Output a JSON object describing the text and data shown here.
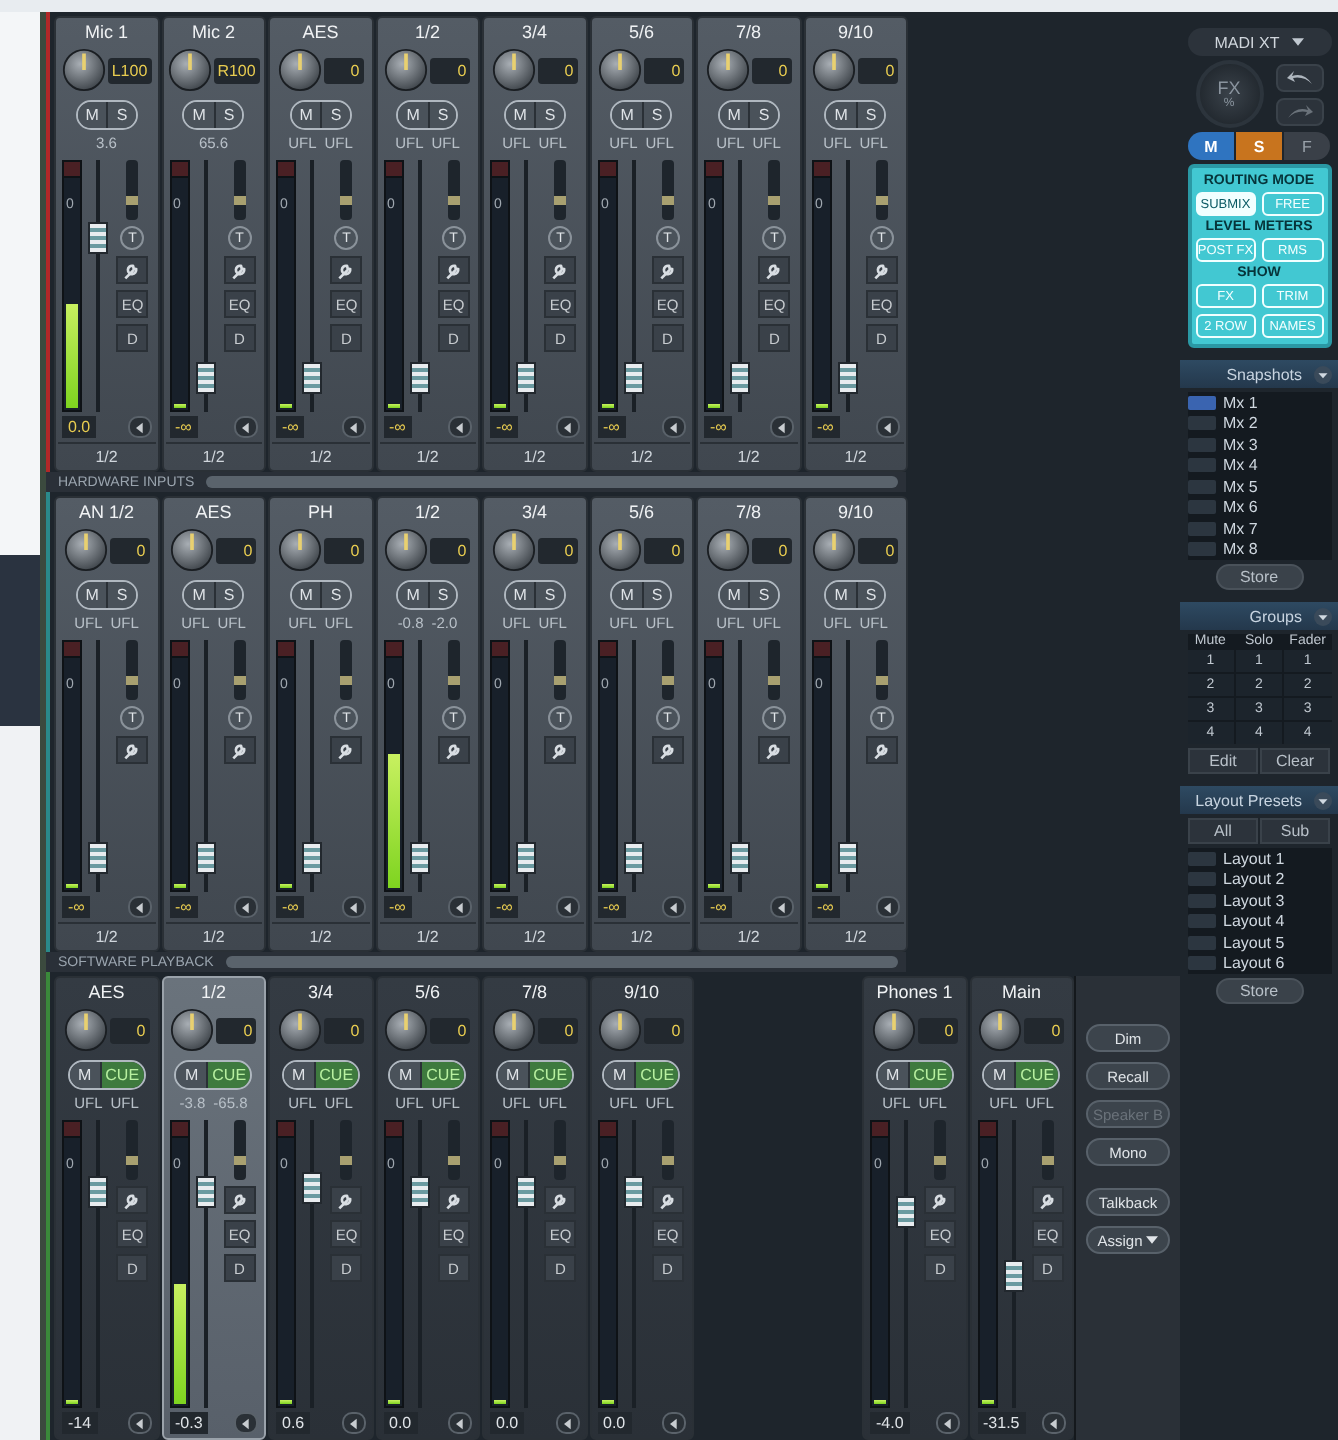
{
  "sections": [
    {
      "kind": "input",
      "footer_label": "HARDWARE INPUTS",
      "channels": [
        {
          "name": "Mic 1",
          "selected": false,
          "knob": {
            "value": "L100"
          },
          "buttons": [
            "M",
            "S"
          ],
          "levels": [
            "3.6"
          ],
          "meter": {
            "level": 0.45,
            "mark": "0"
          },
          "fader": {
            "level": 0.72
          },
          "trim": "T",
          "tools": [
            "EQ",
            "D"
          ],
          "gain": "0.0",
          "routing": "1/2"
        },
        {
          "name": "Mic 2",
          "selected": false,
          "knob": {
            "value": "R100"
          },
          "buttons": [
            "M",
            "S"
          ],
          "levels": [
            "65.6"
          ],
          "meter": {
            "level": 0,
            "mark": "0"
          },
          "fader": {
            "level": 0.08
          },
          "trim": "T",
          "tools": [
            "EQ",
            "D"
          ],
          "gain": "-∞",
          "routing": "1/2"
        },
        {
          "name": "AES",
          "selected": false,
          "knob": {
            "value": "0"
          },
          "buttons": [
            "M",
            "S"
          ],
          "levels": [
            "UFL",
            "UFL"
          ],
          "meter": {
            "level": 0,
            "mark": "0"
          },
          "fader": {
            "level": 0.08
          },
          "trim": "T",
          "tools": [
            "EQ",
            "D"
          ],
          "gain": "-∞",
          "routing": "1/2"
        },
        {
          "name": "1/2",
          "selected": false,
          "knob": {
            "value": "0"
          },
          "buttons": [
            "M",
            "S"
          ],
          "levels": [
            "UFL",
            "UFL"
          ],
          "meter": {
            "level": 0,
            "mark": "0"
          },
          "fader": {
            "level": 0.08
          },
          "trim": "T",
          "tools": [
            "EQ",
            "D"
          ],
          "gain": "-∞",
          "routing": "1/2"
        },
        {
          "name": "3/4",
          "selected": false,
          "knob": {
            "value": "0"
          },
          "buttons": [
            "M",
            "S"
          ],
          "levels": [
            "UFL",
            "UFL"
          ],
          "meter": {
            "level": 0,
            "mark": "0"
          },
          "fader": {
            "level": 0.08
          },
          "trim": "T",
          "tools": [
            "EQ",
            "D"
          ],
          "gain": "-∞",
          "routing": "1/2"
        },
        {
          "name": "5/6",
          "selected": false,
          "knob": {
            "value": "0"
          },
          "buttons": [
            "M",
            "S"
          ],
          "levels": [
            "UFL",
            "UFL"
          ],
          "meter": {
            "level": 0,
            "mark": "0"
          },
          "fader": {
            "level": 0.08
          },
          "trim": "T",
          "tools": [
            "EQ",
            "D"
          ],
          "gain": "-∞",
          "routing": "1/2"
        },
        {
          "name": "7/8",
          "selected": false,
          "knob": {
            "value": "0"
          },
          "buttons": [
            "M",
            "S"
          ],
          "levels": [
            "UFL",
            "UFL"
          ],
          "meter": {
            "level": 0,
            "mark": "0"
          },
          "fader": {
            "level": 0.08
          },
          "trim": "T",
          "tools": [
            "EQ",
            "D"
          ],
          "gain": "-∞",
          "routing": "1/2"
        },
        {
          "name": "9/10",
          "selected": false,
          "knob": {
            "value": "0"
          },
          "buttons": [
            "M",
            "S"
          ],
          "levels": [
            "UFL",
            "UFL"
          ],
          "meter": {
            "level": 0,
            "mark": "0"
          },
          "fader": {
            "level": 0.08
          },
          "trim": "T",
          "tools": [
            "EQ",
            "D"
          ],
          "gain": "-∞",
          "routing": "1/2"
        }
      ]
    },
    {
      "kind": "playback",
      "footer_label": "SOFTWARE PLAYBACK",
      "channels": [
        {
          "name": "AN 1/2",
          "selected": false,
          "knob": {
            "value": "0"
          },
          "buttons": [
            "M",
            "S"
          ],
          "levels": [
            "UFL",
            "UFL"
          ],
          "meter": {
            "level": 0,
            "mark": "0"
          },
          "fader": {
            "level": 0.08
          },
          "trim": "T",
          "gain": "-∞",
          "routing": "1/2"
        },
        {
          "name": "AES",
          "selected": false,
          "knob": {
            "value": "0"
          },
          "buttons": [
            "M",
            "S"
          ],
          "levels": [
            "UFL",
            "UFL"
          ],
          "meter": {
            "level": 0,
            "mark": "0"
          },
          "fader": {
            "level": 0.08
          },
          "trim": "T",
          "gain": "-∞",
          "routing": "1/2"
        },
        {
          "name": "PH",
          "selected": false,
          "knob": {
            "value": "0"
          },
          "buttons": [
            "M",
            "S"
          ],
          "levels": [
            "UFL",
            "UFL"
          ],
          "meter": {
            "level": 0,
            "mark": "0"
          },
          "fader": {
            "level": 0.08
          },
          "trim": "T",
          "gain": "-∞",
          "routing": "1/2"
        },
        {
          "name": "1/2",
          "selected": false,
          "knob": {
            "value": "0"
          },
          "buttons": [
            "M",
            "S"
          ],
          "levels": [
            "-0.8",
            "-2.0"
          ],
          "meter": {
            "level": 0.58,
            "mark": "0"
          },
          "fader": {
            "level": 0.08
          },
          "trim": "T",
          "gain": "-∞",
          "routing": "1/2"
        },
        {
          "name": "3/4",
          "selected": false,
          "knob": {
            "value": "0"
          },
          "buttons": [
            "M",
            "S"
          ],
          "levels": [
            "UFL",
            "UFL"
          ],
          "meter": {
            "level": 0,
            "mark": "0"
          },
          "fader": {
            "level": 0.08
          },
          "trim": "T",
          "gain": "-∞",
          "routing": "1/2"
        },
        {
          "name": "5/6",
          "selected": false,
          "knob": {
            "value": "0"
          },
          "buttons": [
            "M",
            "S"
          ],
          "levels": [
            "UFL",
            "UFL"
          ],
          "meter": {
            "level": 0,
            "mark": "0"
          },
          "fader": {
            "level": 0.08
          },
          "trim": "T",
          "gain": "-∞",
          "routing": "1/2"
        },
        {
          "name": "7/8",
          "selected": false,
          "knob": {
            "value": "0"
          },
          "buttons": [
            "M",
            "S"
          ],
          "levels": [
            "UFL",
            "UFL"
          ],
          "meter": {
            "level": 0,
            "mark": "0"
          },
          "fader": {
            "level": 0.08
          },
          "trim": "T",
          "gain": "-∞",
          "routing": "1/2"
        },
        {
          "name": "9/10",
          "selected": false,
          "knob": {
            "value": "0"
          },
          "buttons": [
            "M",
            "S"
          ],
          "levels": [
            "UFL",
            "UFL"
          ],
          "meter": {
            "level": 0,
            "mark": "0"
          },
          "fader": {
            "level": 0.08
          },
          "trim": "T",
          "gain": "-∞",
          "routing": "1/2"
        }
      ]
    }
  ],
  "outputs": {
    "kind": "output",
    "channels": [
      {
        "name": "AES",
        "selected": false,
        "knob": {
          "value": "0"
        },
        "buttons": [
          "M",
          "CUE"
        ],
        "levels": [
          "UFL",
          "UFL"
        ],
        "meter": {
          "level": 0,
          "mark": "0"
        },
        "fader": {
          "level": 0.78
        },
        "tools": [
          "EQ",
          "D"
        ],
        "gain": "-14"
      },
      {
        "name": "1/2",
        "selected": true,
        "knob": {
          "value": "0"
        },
        "buttons": [
          "M",
          "CUE"
        ],
        "levels": [
          "-3.8",
          "-65.8"
        ],
        "meter": {
          "level": 0.45,
          "mark": "0"
        },
        "fader": {
          "level": 0.78
        },
        "tools": [
          "EQ",
          "D"
        ],
        "gain": "-0.3"
      },
      {
        "name": "3/4",
        "selected": false,
        "knob": {
          "value": "0"
        },
        "buttons": [
          "M",
          "CUE"
        ],
        "levels": [
          "UFL",
          "UFL"
        ],
        "meter": {
          "level": 0,
          "mark": "0"
        },
        "fader": {
          "level": 0.8
        },
        "tools": [
          "EQ",
          "D"
        ],
        "gain": "0.6"
      },
      {
        "name": "5/6",
        "selected": false,
        "knob": {
          "value": "0"
        },
        "buttons": [
          "M",
          "CUE"
        ],
        "levels": [
          "UFL",
          "UFL"
        ],
        "meter": {
          "level": 0,
          "mark": "0"
        },
        "fader": {
          "level": 0.78
        },
        "tools": [
          "EQ",
          "D"
        ],
        "gain": "0.0"
      },
      {
        "name": "7/8",
        "selected": false,
        "knob": {
          "value": "0"
        },
        "buttons": [
          "M",
          "CUE"
        ],
        "levels": [
          "UFL",
          "UFL"
        ],
        "meter": {
          "level": 0,
          "mark": "0"
        },
        "fader": {
          "level": 0.78
        },
        "tools": [
          "EQ",
          "D"
        ],
        "gain": "0.0"
      },
      {
        "name": "9/10",
        "selected": false,
        "knob": {
          "value": "0"
        },
        "buttons": [
          "M",
          "CUE"
        ],
        "levels": [
          "UFL",
          "UFL"
        ],
        "meter": {
          "level": 0,
          "mark": "0"
        },
        "fader": {
          "level": 0.78
        },
        "tools": [
          "EQ",
          "D"
        ],
        "gain": "0.0"
      }
    ],
    "monitors": [
      {
        "name": "Phones 1",
        "selected": false,
        "knob": {
          "value": "0"
        },
        "buttons": [
          "M",
          "CUE"
        ],
        "levels": [
          "UFL",
          "UFL"
        ],
        "meter": {
          "level": 0,
          "mark": "0"
        },
        "fader": {
          "level": 0.7
        },
        "tools": [
          "EQ",
          "D"
        ],
        "gain": "-4.0"
      },
      {
        "name": "Main",
        "selected": false,
        "knob": {
          "value": "0"
        },
        "buttons": [
          "M",
          "CUE"
        ],
        "levels": [
          "UFL",
          "UFL"
        ],
        "meter": {
          "level": 0,
          "mark": "0"
        },
        "fader": {
          "level": 0.45
        },
        "tools": [
          "EQ",
          "D"
        ],
        "gain": "-31.5"
      }
    ],
    "controls": [
      {
        "label": "Dim",
        "disabled": false,
        "dropdown": false
      },
      {
        "label": "Recall",
        "disabled": false,
        "dropdown": false
      },
      {
        "label": "Speaker B",
        "disabled": true,
        "dropdown": false
      },
      {
        "label": "Mono",
        "disabled": false,
        "dropdown": false
      },
      {
        "label": "Talkback",
        "disabled": false,
        "dropdown": false
      },
      {
        "label": "Assign",
        "disabled": false,
        "dropdown": true
      }
    ]
  },
  "panel": {
    "device": "MADI XT",
    "fx_label": "FX",
    "fx_unit": "%",
    "mode_buttons": [
      {
        "label": "M",
        "selected": true,
        "color": "#2f74c0"
      },
      {
        "label": "S",
        "selected": true,
        "color": "#c8741e"
      },
      {
        "label": "F",
        "selected": false,
        "color": "#3a4048"
      }
    ],
    "settings": [
      {
        "title": "ROUTING MODE",
        "options": [
          {
            "label": "SUBMIX",
            "selected": true
          },
          {
            "label": "FREE",
            "selected": false
          }
        ]
      },
      {
        "title": "LEVEL METERS",
        "options": [
          {
            "label": "POST FX",
            "selected": false
          },
          {
            "label": "RMS",
            "selected": false
          }
        ]
      },
      {
        "title": "SHOW",
        "options": [
          {
            "label": "FX",
            "selected": false
          },
          {
            "label": "TRIM",
            "selected": false
          },
          {
            "label": "2 ROW",
            "selected": false
          },
          {
            "label": "NAMES",
            "selected": false
          }
        ]
      }
    ],
    "snapshots": {
      "title": "Snapshots",
      "items": [
        {
          "label": "Mx 1",
          "selected": true
        },
        {
          "label": "Mx 2",
          "selected": false
        },
        {
          "label": "Mx 3",
          "selected": false
        },
        {
          "label": "Mx 4",
          "selected": false
        },
        {
          "label": "Mx 5",
          "selected": false
        },
        {
          "label": "Mx 6",
          "selected": false
        },
        {
          "label": "Mx 7",
          "selected": false
        },
        {
          "label": "Mx 8",
          "selected": false
        }
      ],
      "button": "Store"
    },
    "groups": {
      "title": "Groups",
      "columns": [
        "Mute",
        "Solo",
        "Fader"
      ],
      "rows": [
        [
          "1",
          "1",
          "1"
        ],
        [
          "2",
          "2",
          "2"
        ],
        [
          "3",
          "3",
          "3"
        ],
        [
          "4",
          "4",
          "4"
        ]
      ],
      "buttons": [
        "Edit",
        "Clear"
      ]
    },
    "layouts": {
      "title": "Layout Presets",
      "tabs": [
        "All",
        "Sub"
      ],
      "items": [
        {
          "label": "Layout 1",
          "selected": false
        },
        {
          "label": "Layout 2",
          "selected": false
        },
        {
          "label": "Layout 3",
          "selected": false
        },
        {
          "label": "Layout 4",
          "selected": false
        },
        {
          "label": "Layout 5",
          "selected": false
        },
        {
          "label": "Layout 6",
          "selected": false
        }
      ],
      "button": "Store"
    }
  }
}
